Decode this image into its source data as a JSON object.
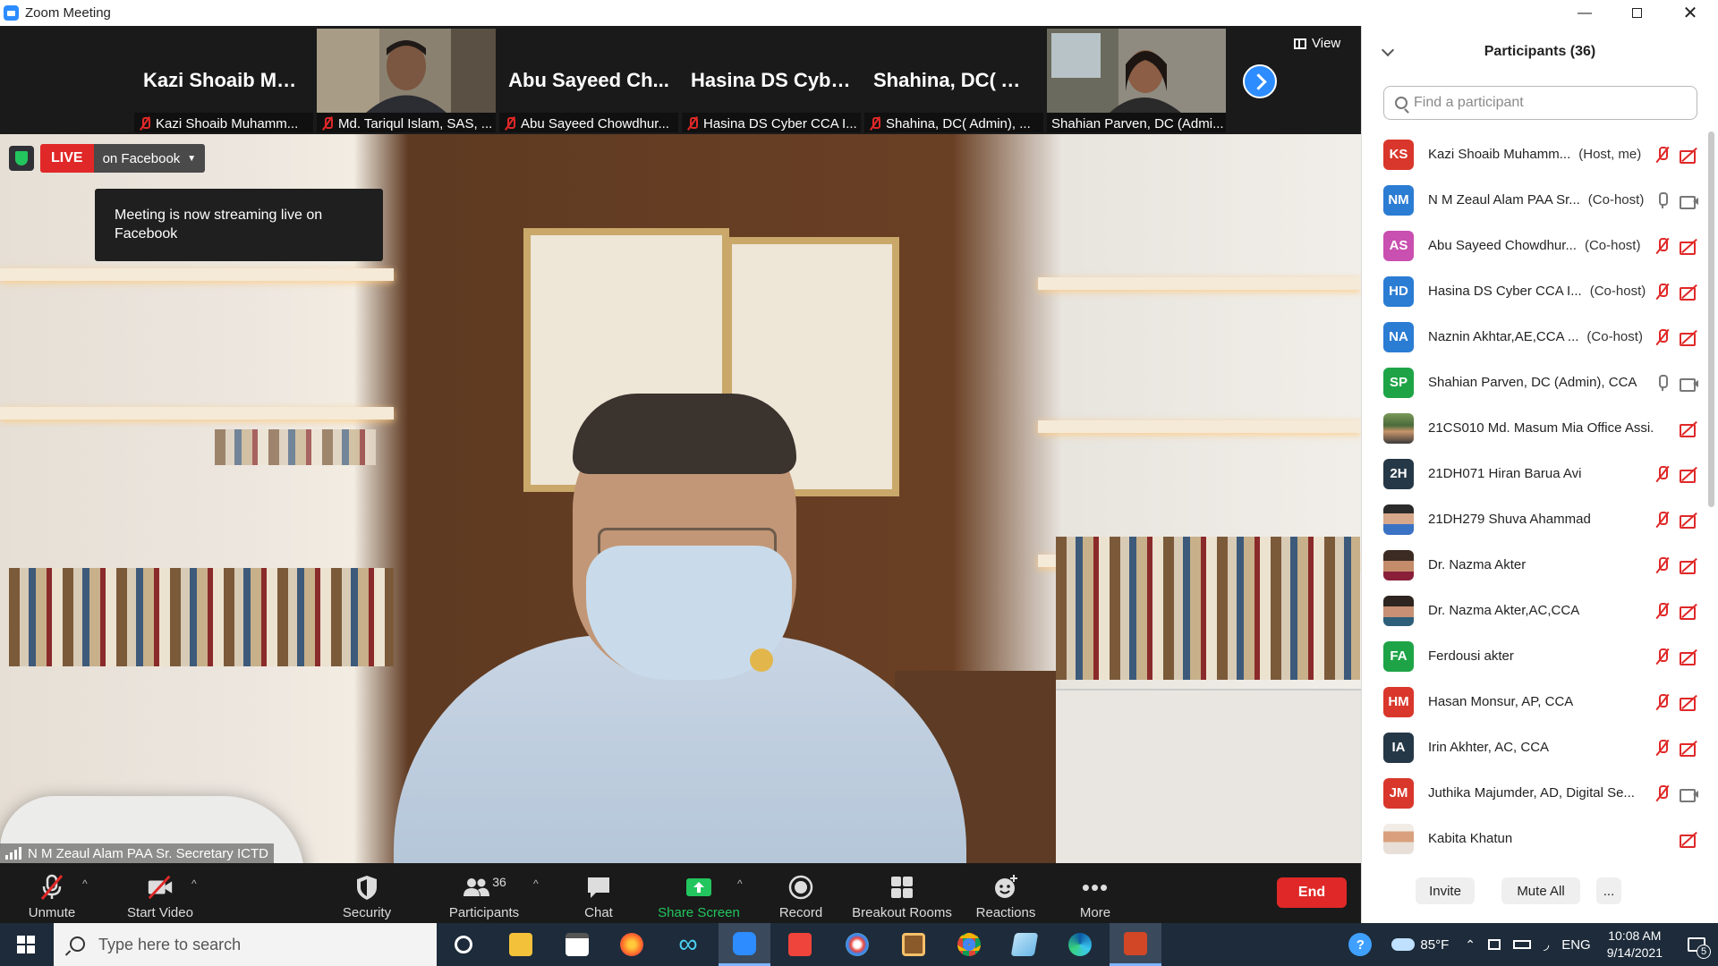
{
  "window": {
    "title": "Zoom Meeting"
  },
  "thumbnails": [
    {
      "big_name": "Kazi Shoaib Mu...",
      "label": "Kazi Shoaib Muhamm...",
      "has_video": false
    },
    {
      "big_name": "",
      "label": "Md. Tariqul Islam, SAS, ...",
      "has_video": true
    },
    {
      "big_name": "Abu Sayeed Ch...",
      "label": "Abu Sayeed Chowdhur...",
      "has_video": false
    },
    {
      "big_name": "Hasina DS Cybe...",
      "label": "Hasina DS Cyber CCA I...",
      "has_video": false
    },
    {
      "big_name": "Shahina, DC( Ad...",
      "label": "Shahina, DC( Admin), ...",
      "has_video": false
    },
    {
      "big_name": "",
      "label": "Shahian Parven, DC (Admi...",
      "has_video": true
    }
  ],
  "view_button": {
    "label": "View"
  },
  "live": {
    "badge": "LIVE",
    "platform": "on Facebook",
    "tooltip": "Meeting is now streaming live on Facebook"
  },
  "active_speaker": {
    "name": "N M Zeaul Alam PAA Sr. Secretary ICTD"
  },
  "toolbar": {
    "unmute": "Unmute",
    "start_video": "Start Video",
    "security": "Security",
    "participants": "Participants",
    "participants_count": "36",
    "chat": "Chat",
    "share_screen": "Share Screen",
    "record": "Record",
    "breakout_rooms": "Breakout Rooms",
    "reactions": "Reactions",
    "more": "More",
    "end": "End"
  },
  "panel": {
    "title": "Participants (36)",
    "search_placeholder": "Find a participant",
    "invite": "Invite",
    "mute_all": "Mute All",
    "more": "...",
    "participants": [
      {
        "initials": "KS",
        "color": "#d9372b",
        "name": "Kazi Shoaib Muhamm...",
        "role": "(Host, me)",
        "mic": "off",
        "cam": "off"
      },
      {
        "initials": "NM",
        "color": "#2b7cd3",
        "name": "N M Zeaul Alam PAA Sr...",
        "role": "(Co-host)",
        "mic": "on",
        "cam": "on"
      },
      {
        "initials": "AS",
        "color": "#c94fb0",
        "name": "Abu Sayeed Chowdhur...",
        "role": "(Co-host)",
        "mic": "off",
        "cam": "off"
      },
      {
        "initials": "HD",
        "color": "#2b7cd3",
        "name": "Hasina DS Cyber CCA I...",
        "role": "(Co-host)",
        "mic": "off",
        "cam": "off"
      },
      {
        "initials": "NA",
        "color": "#2b7cd3",
        "name": "Naznin Akhtar,AE,CCA ...",
        "role": "(Co-host)",
        "mic": "off",
        "cam": "off"
      },
      {
        "initials": "SP",
        "color": "#1ea446",
        "name": "Shahian Parven, DC (Admin), CCA",
        "role": "",
        "mic": "on",
        "cam": "on"
      },
      {
        "initials": "",
        "color": "",
        "photo": "photo1",
        "name": "21CS010 Md. Masum Mia Office Assi...",
        "role": "",
        "mic": "none",
        "cam": "off"
      },
      {
        "initials": "2H",
        "color": "#253847",
        "name": "21DH071 Hiran Barua Avi",
        "role": "",
        "mic": "off",
        "cam": "off"
      },
      {
        "initials": "",
        "color": "",
        "photo": "photo2",
        "name": "21DH279 Shuva Ahammad",
        "role": "",
        "mic": "off",
        "cam": "off"
      },
      {
        "initials": "",
        "color": "",
        "photo": "photo3",
        "name": "Dr. Nazma Akter",
        "role": "",
        "mic": "off",
        "cam": "off"
      },
      {
        "initials": "",
        "color": "",
        "photo": "photo4",
        "name": "Dr. Nazma Akter,AC,CCA",
        "role": "",
        "mic": "off",
        "cam": "off"
      },
      {
        "initials": "FA",
        "color": "#1ea446",
        "name": "Ferdousi akter",
        "role": "",
        "mic": "off",
        "cam": "off"
      },
      {
        "initials": "HM",
        "color": "#d9372b",
        "name": "Hasan Monsur, AP, CCA",
        "role": "",
        "mic": "off",
        "cam": "off"
      },
      {
        "initials": "IA",
        "color": "#253847",
        "name": "Irin Akhter, AC, CCA",
        "role": "",
        "mic": "off",
        "cam": "off"
      },
      {
        "initials": "JM",
        "color": "#d9372b",
        "name": "Juthika Majumder, AD,  Digital Se...",
        "role": "",
        "mic": "off",
        "cam": "on"
      },
      {
        "initials": "",
        "color": "",
        "photo": "photo5",
        "name": "Kabita Khatun",
        "role": "",
        "mic": "none",
        "cam": "off"
      }
    ]
  },
  "taskbar": {
    "search_placeholder": "Type here to search",
    "weather": "85°F",
    "language": "ENG",
    "time": "10:08 AM",
    "date": "9/14/2021",
    "notification_count": "5"
  }
}
